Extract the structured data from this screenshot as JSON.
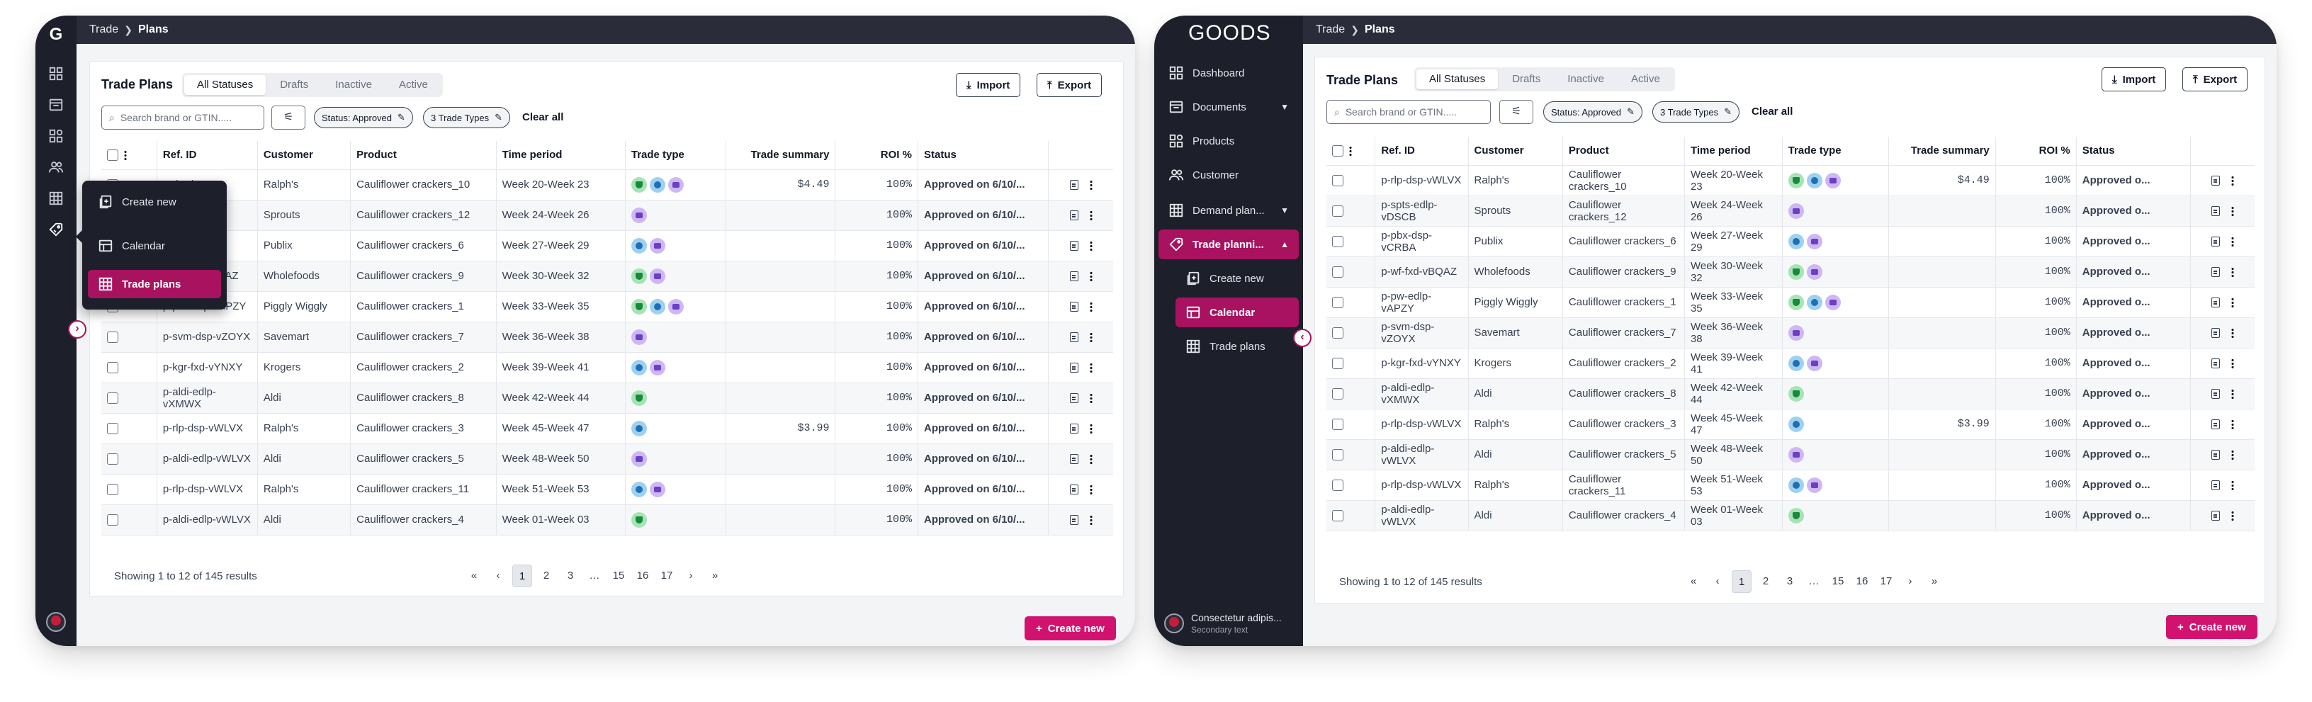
{
  "breadcrumb": {
    "root": "Trade",
    "current": "Plans"
  },
  "page": {
    "title": "Trade Plans",
    "tabs": [
      "All Statuses",
      "Drafts",
      "Inactive",
      "Active"
    ],
    "import_label": "Import",
    "export_label": "Export",
    "search_placeholder": "Search brand or GTIN.....",
    "chip_status": "Status: Approved",
    "chip_types": "3 Trade Types",
    "clear_all": "Clear all",
    "create_new": "Create new"
  },
  "table": {
    "headers": [
      "Ref. ID",
      "Customer",
      "Product",
      "Time period",
      "Trade type",
      "Trade  summary",
      "ROI %",
      "Status"
    ],
    "rows": [
      {
        "ref": "p-rlp-dsp-vWLVX",
        "customer": "Ralph's",
        "product": "Cauliflower crackers_10",
        "period": "Week 20-Week 23",
        "types": [
          "g",
          "b",
          "p"
        ],
        "summary": "$4.49",
        "roi": "100%",
        "status_a": "Approved on 6/10/...",
        "status_b": "Approved o..."
      },
      {
        "ref": "p-spts-edlp-vDSCB",
        "customer": "Sprouts",
        "product": "Cauliflower crackers_12",
        "period": "Week 24-Week 26",
        "types": [
          "p"
        ],
        "summary": "",
        "roi": "100%",
        "status_a": "Approved on 6/10/...",
        "status_b": "Approved o..."
      },
      {
        "ref": "p-pbx-dsp-vCRBA",
        "customer": "Publix",
        "product": "Cauliflower crackers_6",
        "period": "Week 27-Week 29",
        "types": [
          "b",
          "p"
        ],
        "summary": "",
        "roi": "100%",
        "status_a": "Approved on 6/10/...",
        "status_b": "Approved o..."
      },
      {
        "ref": "p-wf-fxd-vBQAZ",
        "customer": "Wholefoods",
        "product": "Cauliflower crackers_9",
        "period": "Week 30-Week 32",
        "types": [
          "g",
          "p"
        ],
        "summary": "",
        "roi": "100%",
        "status_a": "Approved on 6/10/...",
        "status_b": "Approved o..."
      },
      {
        "ref": "p-pw-edlp-vAPZY",
        "customer": "Piggly Wiggly",
        "product": "Cauliflower crackers_1",
        "period": "Week 33-Week 35",
        "types": [
          "g",
          "b",
          "p"
        ],
        "summary": "",
        "roi": "100%",
        "status_a": "Approved on 6/10/...",
        "status_b": "Approved o..."
      },
      {
        "ref": "p-svm-dsp-vZOYX",
        "customer": "Savemart",
        "product": "Cauliflower crackers_7",
        "period": "Week 36-Week 38",
        "types": [
          "p"
        ],
        "summary": "",
        "roi": "100%",
        "status_a": "Approved on 6/10/...",
        "status_b": "Approved o..."
      },
      {
        "ref": "p-kgr-fxd-vYNXY",
        "customer": "Krogers",
        "product": "Cauliflower crackers_2",
        "period": "Week 39-Week 41",
        "types": [
          "b",
          "p"
        ],
        "summary": "",
        "roi": "100%",
        "status_a": "Approved on 6/10/...",
        "status_b": "Approved o..."
      },
      {
        "ref": "p-aldi-edlp-vXMWX",
        "customer": "Aldi",
        "product": "Cauliflower crackers_8",
        "period": "Week 42-Week 44",
        "types": [
          "g"
        ],
        "summary": "",
        "roi": "100%",
        "status_a": "Approved on 6/10/...",
        "status_b": "Approved o..."
      },
      {
        "ref": "p-rlp-dsp-vWLVX",
        "customer": "Ralph's",
        "product": "Cauliflower crackers_3",
        "period": "Week 45-Week 47",
        "types": [
          "b"
        ],
        "summary": "$3.99",
        "roi": "100%",
        "status_a": "Approved on 6/10/...",
        "status_b": "Approved o..."
      },
      {
        "ref": "p-aldi-edlp-vWLVX",
        "customer": "Aldi",
        "product": "Cauliflower crackers_5",
        "period": "Week 48-Week 50",
        "types": [
          "p"
        ],
        "summary": "",
        "roi": "100%",
        "status_a": "Approved on 6/10/...",
        "status_b": "Approved o..."
      },
      {
        "ref": "p-rlp-dsp-vWLVX",
        "customer": "Ralph's",
        "product": "Cauliflower crackers_11",
        "period": "Week 51-Week 53",
        "types": [
          "b",
          "p"
        ],
        "summary": "",
        "roi": "100%",
        "status_a": "Approved on 6/10/...",
        "status_b": "Approved o..."
      },
      {
        "ref": "p-aldi-edlp-vWLVX",
        "customer": "Aldi",
        "product": "Cauliflower crackers_4",
        "period": "Week 01-Week 03",
        "types": [
          "g"
        ],
        "summary": "",
        "roi": "100%",
        "status_a": "Approved on 6/10/...",
        "status_b": "Approved o..."
      }
    ],
    "frameA_refs_visible": [
      "p-rlp-dsp-",
      "",
      "",
      "p-wf-fxd-vBQAZ",
      "p-pw-edlp-vAPZY",
      "p-svm-dsp-vZOYX",
      "p-kgr-fxd-vYNXY",
      "p-aldi-edlp-vXMWX",
      "p-rlp-dsp-vWLVX",
      "p-aldi-edlp-vWLVX",
      "p-rlp-dsp-vWLVX",
      "p-aldi-edlp-vWLVX"
    ]
  },
  "footer": {
    "showing": "Showing 1 to 12 of 145 results",
    "pages": [
      "«",
      "‹",
      "1",
      "2",
      "3",
      "…",
      "15",
      "16",
      "17",
      "›",
      "»"
    ],
    "current_page": "1"
  },
  "rail_popover": {
    "items": [
      "Create new",
      "Calendar",
      "Trade plans"
    ],
    "active": "Trade plans"
  },
  "sidebar": {
    "brand": "GOODS",
    "items": [
      "Dashboard",
      "Documents",
      "Products",
      "Customer",
      "Demand plan...",
      "Trade planni..."
    ],
    "sub_items": [
      "Create new",
      "Calendar",
      "Trade plans"
    ],
    "user_name": "Consectetur adipis...",
    "user_sub": "Secondary text"
  },
  "colors": {
    "accent": "#d1136f",
    "accent_dark": "#a8125e",
    "sidebar": "#1d1f2b",
    "status": "#0f8f7a"
  }
}
